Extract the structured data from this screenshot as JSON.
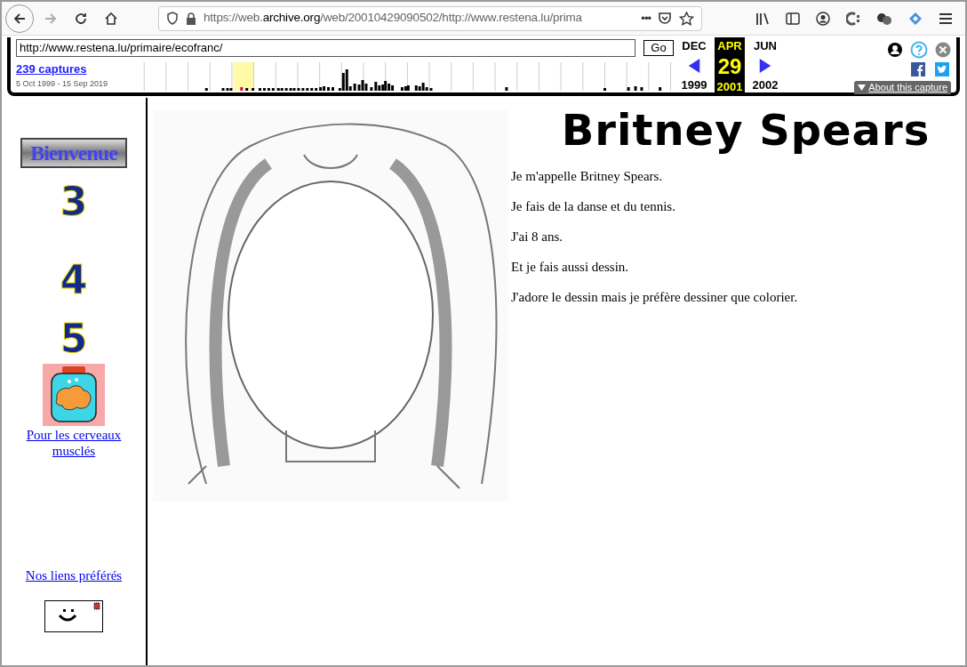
{
  "browser": {
    "url_parts": [
      {
        "kind": "dim",
        "text": "https://web."
      },
      {
        "kind": "domain",
        "text": "archive.org"
      },
      {
        "kind": "dim",
        "text": "/web/20010429090502/http://www.restena.lu/prima"
      }
    ],
    "more": "•••"
  },
  "wayback": {
    "url": "http://www.restena.lu/primaire/ecofranc/",
    "go": "Go",
    "captures": "239 captures",
    "range": "5 Oct 1999 - 15 Sep 2019",
    "calendar": [
      {
        "month": "DEC",
        "year": "1999",
        "selected": false
      },
      {
        "month": "APR",
        "day": "29",
        "year": "2001",
        "selected": true
      },
      {
        "month": "JUN",
        "year": "2002",
        "selected": false
      }
    ],
    "about": "About this capture"
  },
  "sidebar": {
    "banner": "Bienvenue",
    "numerals": [
      "3",
      "4",
      "5"
    ],
    "brain_link": "Pour les cerveaux musclés",
    "links_link": "Nos liens préférés"
  },
  "main": {
    "title": "Britney Spears",
    "paragraphs": [
      "Je m'appelle Britney Spears.",
      "Je fais de la danse et du tennis.",
      "J'ai 8 ans.",
      "Et je fais aussi dessin.",
      "J'adore le dessin mais je préfère dessiner que colorier."
    ]
  }
}
